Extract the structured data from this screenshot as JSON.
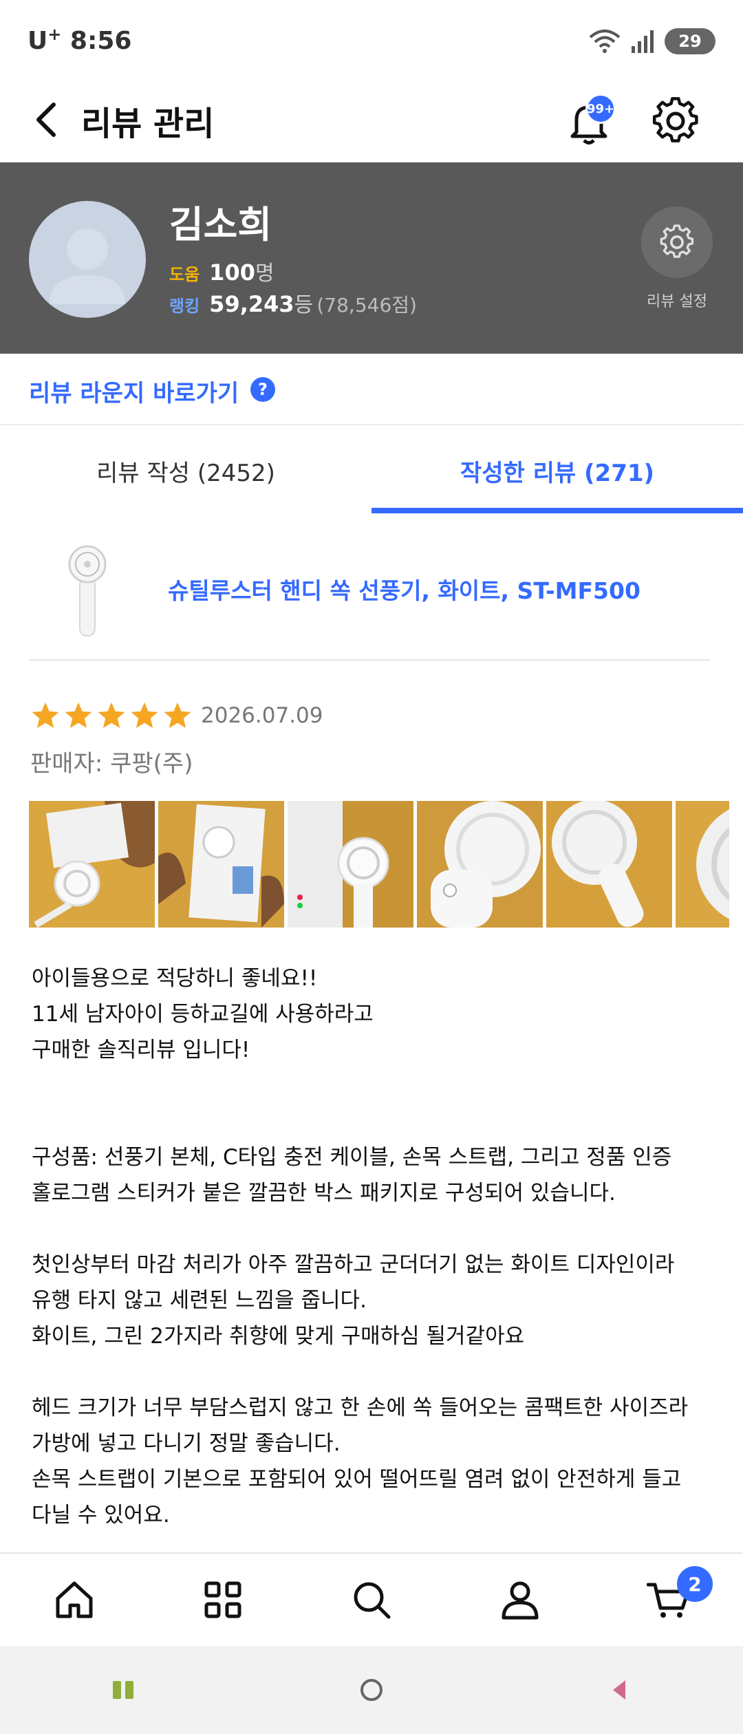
{
  "status_bar": {
    "carrier": "U",
    "carrier_sup": "+",
    "time": "8:56",
    "battery": "29"
  },
  "header": {
    "title": "리뷰 관리",
    "notification_badge": "99+"
  },
  "profile": {
    "name": "김소희",
    "help_label": "도움",
    "help_count": "100",
    "help_unit": "명",
    "rank_label": "랭킹",
    "rank_value": "59,243",
    "rank_unit": "등",
    "score": "(78,546점)",
    "settings_label": "리뷰 설정"
  },
  "lounge": {
    "link_text": "리뷰 라운지 바로가기",
    "help_icon": "?"
  },
  "tabs": [
    {
      "label": "리뷰 작성 (2452)"
    },
    {
      "label": "작성한 리뷰 (271)"
    }
  ],
  "product": {
    "title": "슈틸루스터 핸디 쏙 선풍기, 화이트, ST-MF500"
  },
  "review": {
    "rating": 5,
    "date": "2026.07.09",
    "seller": "판매자: 쿠팡(주)",
    "title": "아이들용으로 적당하니 좋네요!!",
    "body_1": "11세 남자아이 등하교길에 사용하라고\n구매한 솔직리뷰 입니다!",
    "body_2": "구성품: 선풍기 본체, C타입 충전 케이블, 손목 스트랩, 그리고 정품 인증\n홀로그램 스티커가 붙은 깔끔한 박스 패키지로 구성되어 있습니다.",
    "body_3": "첫인상부터 마감 처리가 아주 깔끔하고 군더더기 없는 화이트 디자인이라\n유행 타지 않고 세련된 느낌을 줍니다.\n화이트, 그린 2가지라 취향에 맞게 구매하심 될거같아요",
    "body_4": "헤드 크기가 너무 부담스럽지 않고 한 손에 쏙 들어오는 콤팩트한 사이즈라\n가방에 넣고 다니기 정말 좋습니다.\n손목 스트랩이 기본으로 포함되어 있어 떨어뜨릴 염려 없이 안전하게 들고\n다닐 수 있어요."
  },
  "bottom_nav": {
    "cart_badge": "2"
  },
  "colors": {
    "accent": "#346aff",
    "banner": "#595959",
    "star": "#f5a623",
    "help_label": "#f5b400"
  }
}
